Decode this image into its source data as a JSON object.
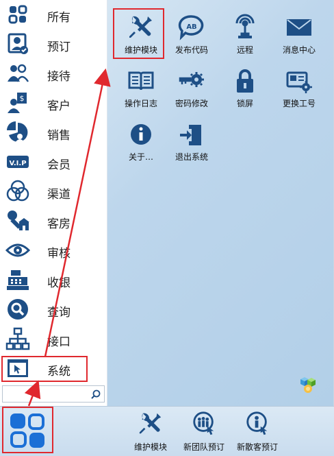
{
  "sidebar": {
    "items": [
      {
        "label": "所有",
        "icon": "apps-grid-icon"
      },
      {
        "label": "预订",
        "icon": "booking-user-icon"
      },
      {
        "label": "接待",
        "icon": "reception-people-icon"
      },
      {
        "label": "客户",
        "icon": "customer-money-icon"
      },
      {
        "label": "销售",
        "icon": "sales-pie-icon"
      },
      {
        "label": "会员",
        "icon": "vip-card-icon"
      },
      {
        "label": "渠道",
        "icon": "channel-circles-icon"
      },
      {
        "label": "客房",
        "icon": "room-key-icon"
      },
      {
        "label": "审核",
        "icon": "audit-eye-icon"
      },
      {
        "label": "收银",
        "icon": "cash-register-icon"
      },
      {
        "label": "查询",
        "icon": "query-magnifier-icon"
      },
      {
        "label": "接口",
        "icon": "interface-network-icon"
      },
      {
        "label": "系统",
        "icon": "system-window-icon"
      }
    ],
    "search": {
      "placeholder": "",
      "value": ""
    }
  },
  "panel": {
    "tiles": [
      {
        "label": "维护模块",
        "icon": "wrench-screwdriver-icon"
      },
      {
        "label": "发布代码",
        "icon": "speech-bubble-ab-icon"
      },
      {
        "label": "远程",
        "icon": "remote-antenna-icon"
      },
      {
        "label": "消息中心",
        "icon": "envelope-icon"
      },
      {
        "label": "操作日志",
        "icon": "book-log-icon"
      },
      {
        "label": "密码修改",
        "icon": "key-gear-icon"
      },
      {
        "label": "锁屏",
        "icon": "padlock-icon"
      },
      {
        "label": "更换工号",
        "icon": "id-card-gear-icon"
      },
      {
        "label": "关于…",
        "icon": "info-circle-icon"
      },
      {
        "label": "退出系统",
        "icon": "exit-door-icon"
      }
    ]
  },
  "taskbar": {
    "start_icon": "start-menu-icon",
    "buttons": [
      {
        "label": "维护模块",
        "icon": "wrench-screwdriver-icon"
      },
      {
        "label": "新团队预订",
        "icon": "team-booking-icon"
      },
      {
        "label": "新散客预订",
        "icon": "individual-booking-icon"
      }
    ]
  },
  "colors": {
    "icon_blue": "#1e4f86",
    "panel_bg": "#bdd6ec",
    "annotation_red": "#e0282e"
  }
}
